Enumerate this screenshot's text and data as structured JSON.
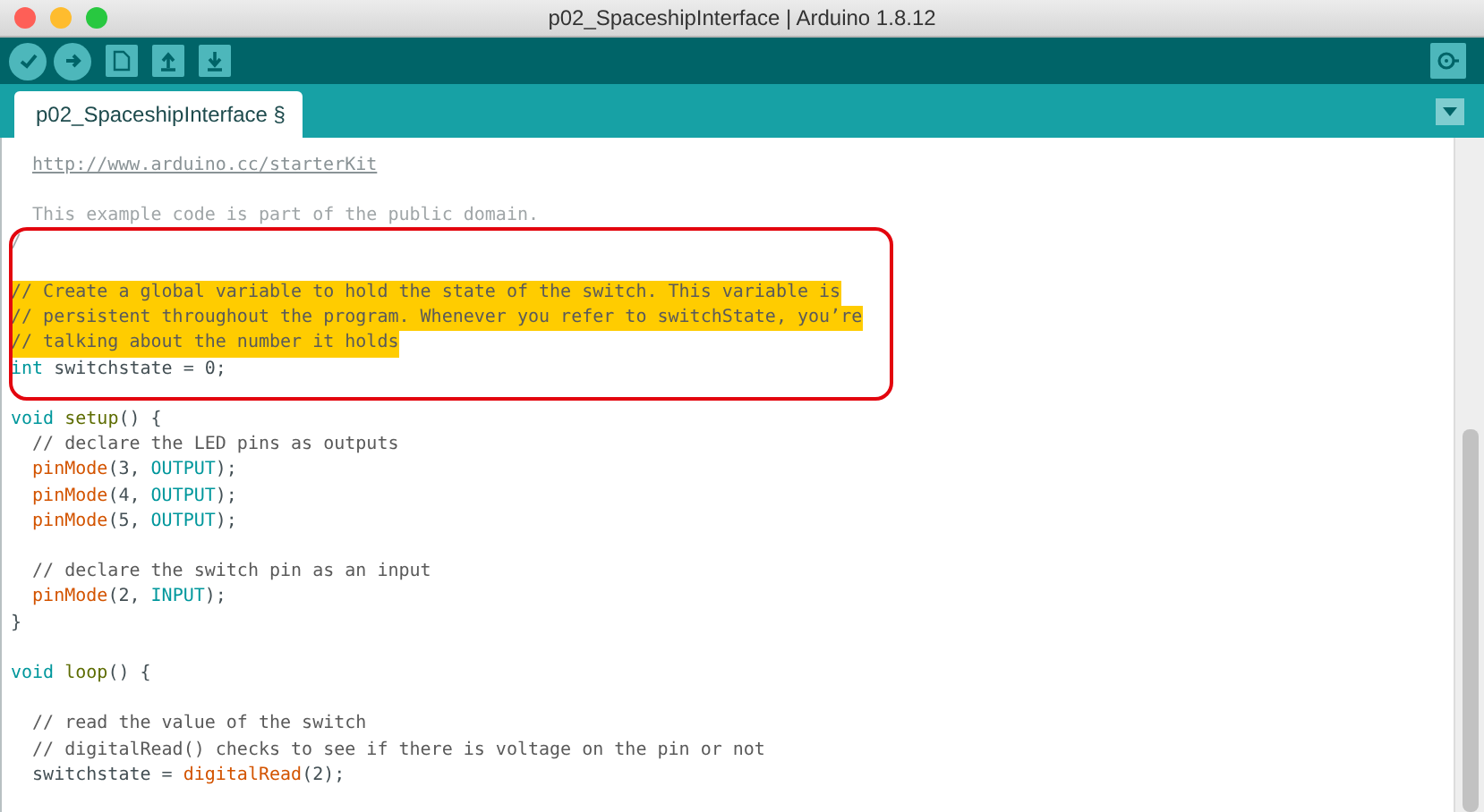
{
  "window": {
    "title": "p02_SpaceshipInterface | Arduino 1.8.12"
  },
  "tabs": [
    {
      "label": "p02_SpaceshipInterface §",
      "selected": true
    }
  ],
  "lines": [
    {
      "kind": "code",
      "highlighted": false,
      "tokens": [
        {
          "kind": "link",
          "text": "http://www.arduino.cc/starterKit"
        }
      ]
    },
    {
      "kind": "blank"
    },
    {
      "kind": "code",
      "highlighted": false,
      "tokens": [
        {
          "kind": "doc",
          "text": "  This example code is part of the public domain."
        }
      ]
    },
    {
      "kind": "code",
      "highlighted": false,
      "tokens": [
        {
          "kind": "doc",
          "text": "/"
        }
      ]
    },
    {
      "kind": "blank"
    },
    {
      "kind": "code",
      "highlighted": true,
      "tokens": [
        {
          "kind": "comment",
          "text": "// Create a global variable to hold the state of the switch. This variable is"
        }
      ]
    },
    {
      "kind": "code",
      "highlighted": true,
      "tokens": [
        {
          "kind": "comment",
          "text": "// persistent throughout the program. Whenever you refer to switchState, you’re"
        }
      ]
    },
    {
      "kind": "code",
      "highlighted": true,
      "tokens": [
        {
          "kind": "comment",
          "text": "// talking about the number it holds"
        }
      ]
    },
    {
      "kind": "code",
      "highlighted": false,
      "tokens": [
        {
          "kind": "keyword",
          "text": "int"
        },
        {
          "kind": "plain",
          "text": " switchstate = 0;"
        }
      ]
    },
    {
      "kind": "blank"
    },
    {
      "kind": "code",
      "highlighted": false,
      "tokens": [
        {
          "kind": "keyword",
          "text": "void"
        },
        {
          "kind": "structure",
          "text": " setup"
        },
        {
          "kind": "plain",
          "text": "() {"
        }
      ]
    },
    {
      "kind": "code",
      "highlighted": false,
      "tokens": [
        {
          "kind": "comment",
          "text": "  // declare the LED pins as outputs"
        }
      ]
    },
    {
      "kind": "code",
      "highlighted": false,
      "tokens": [
        {
          "kind": "function",
          "text": "  pinMode"
        },
        {
          "kind": "plain",
          "text": "(3, "
        },
        {
          "kind": "keyword",
          "text": "OUTPUT"
        },
        {
          "kind": "plain",
          "text": ");"
        }
      ]
    },
    {
      "kind": "code",
      "highlighted": false,
      "tokens": [
        {
          "kind": "function",
          "text": "  pinMode"
        },
        {
          "kind": "plain",
          "text": "(4, "
        },
        {
          "kind": "keyword",
          "text": "OUTPUT"
        },
        {
          "kind": "plain",
          "text": ");"
        }
      ]
    },
    {
      "kind": "code",
      "highlighted": false,
      "tokens": [
        {
          "kind": "function",
          "text": "  pinMode"
        },
        {
          "kind": "plain",
          "text": "(5, "
        },
        {
          "kind": "keyword",
          "text": "OUTPUT"
        },
        {
          "kind": "plain",
          "text": ");"
        }
      ]
    },
    {
      "kind": "blank"
    },
    {
      "kind": "code",
      "highlighted": false,
      "tokens": [
        {
          "kind": "comment",
          "text": "  // declare the switch pin as an input"
        }
      ]
    },
    {
      "kind": "code",
      "highlighted": false,
      "tokens": [
        {
          "kind": "function",
          "text": "  pinMode"
        },
        {
          "kind": "plain",
          "text": "(2, "
        },
        {
          "kind": "keyword",
          "text": "INPUT"
        },
        {
          "kind": "plain",
          "text": ");"
        }
      ]
    },
    {
      "kind": "code",
      "highlighted": false,
      "tokens": [
        {
          "kind": "plain",
          "text": "}"
        }
      ]
    },
    {
      "kind": "blank"
    },
    {
      "kind": "code",
      "highlighted": false,
      "tokens": [
        {
          "kind": "keyword",
          "text": "void"
        },
        {
          "kind": "structure",
          "text": " loop"
        },
        {
          "kind": "plain",
          "text": "() {"
        }
      ]
    },
    {
      "kind": "blank"
    },
    {
      "kind": "code",
      "highlighted": false,
      "tokens": [
        {
          "kind": "comment",
          "text": "  // read the value of the switch"
        }
      ]
    },
    {
      "kind": "code",
      "highlighted": false,
      "tokens": [
        {
          "kind": "comment",
          "text": "  // digitalRead() checks to see if there is voltage on the pin or not"
        }
      ]
    },
    {
      "kind": "code",
      "highlighted": false,
      "tokens": [
        {
          "kind": "plain",
          "text": "  switchstate = "
        },
        {
          "kind": "function",
          "text": "digitalRead"
        },
        {
          "kind": "plain",
          "text": "(2);"
        }
      ]
    }
  ]
}
